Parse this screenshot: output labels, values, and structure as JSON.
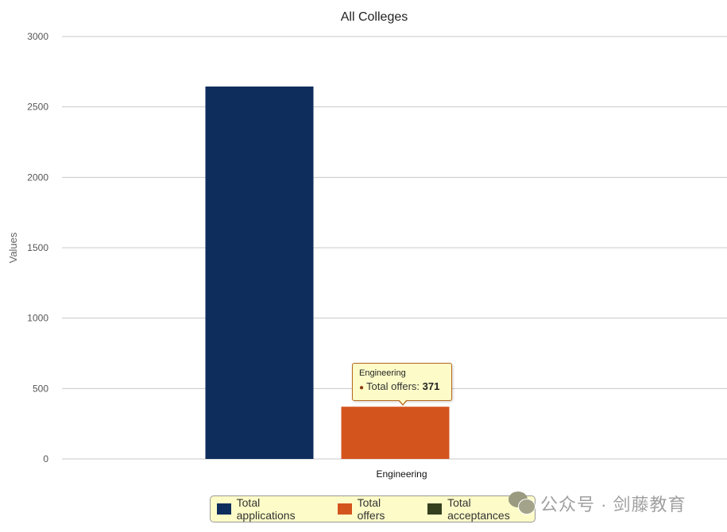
{
  "chart_data": {
    "type": "bar",
    "title": "All Colleges",
    "xlabel": "",
    "ylabel": "Values",
    "ylim": [
      0,
      3000
    ],
    "yticks": [
      0,
      500,
      1000,
      1500,
      2000,
      2500,
      3000
    ],
    "categories": [
      "Engineering"
    ],
    "series": [
      {
        "name": "Total applications",
        "color": "#0f2d5c",
        "values": [
          2645
        ]
      },
      {
        "name": "Total offers",
        "color": "#d4541e",
        "values": [
          371
        ]
      },
      {
        "name": "Total acceptances",
        "color": "#343f1e",
        "values": [
          0
        ]
      }
    ],
    "grid": true,
    "legend_position": "bottom"
  },
  "tooltip": {
    "category": "Engineering",
    "series_label": "Total offers: ",
    "value": "371",
    "bullet": "●"
  },
  "legend": {
    "items": [
      {
        "label": "Total applications",
        "color": "#0f2d5c"
      },
      {
        "label": "Total offers",
        "color": "#d4541e"
      },
      {
        "label": "Total acceptances",
        "color": "#343f1e"
      }
    ]
  },
  "watermark": {
    "text": "公众号 · 剑藤教育"
  }
}
